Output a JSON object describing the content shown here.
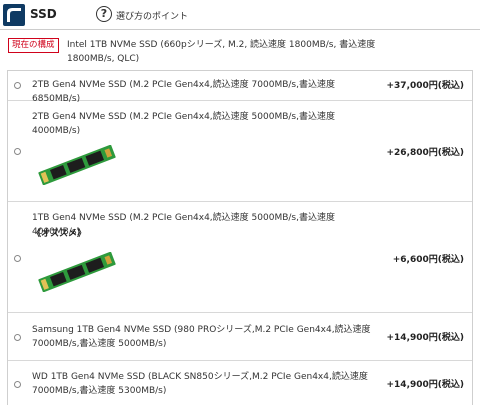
{
  "header": {
    "title": "SSD",
    "help_link": "選び方のポイント"
  },
  "current": {
    "badge": "現在の構成",
    "text": "Intel 1TB NVMe SSD (660pシリーズ, M.2, 読込速度 1800MB/s, 書込速度 1800MB/s, QLC)"
  },
  "options": [
    {
      "label": "2TB Gen4 NVMe SSD (M.2 PCIe Gen4x4,読込速度 7000MB/s,書込速度 6850MB/s)",
      "price": "+37,000円(税込)",
      "recommend": "",
      "image": ""
    },
    {
      "label": "2TB Gen4 NVMe SSD (M.2 PCIe Gen4x4,読込速度 5000MB/s,書込速度 4000MB/s)",
      "price": "+26,800円(税込)",
      "recommend": "",
      "image": "ssd-module"
    },
    {
      "label": "1TB Gen4 NVMe SSD (M.2 PCIe Gen4x4,読込速度 5000MB/s,書込速度 4000MB/s)",
      "price": "+6,600円(税込)",
      "recommend": "《オススメ》",
      "image": "ssd-module"
    },
    {
      "label": "Samsung 1TB Gen4 NVMe SSD (980 PROシリーズ,M.2 PCIe Gen4x4,読込速度 7000MB/s,書込速度 5000MB/s)",
      "price": "+14,900円(税込)",
      "recommend": "",
      "image": ""
    },
    {
      "label": "WD 1TB Gen4 NVMe SSD (BLACK SN850シリーズ,M.2 PCIe Gen4x4,読込速度 7000MB/s,書込速度 5300MB/s)",
      "price": "+14,900円(税込)",
      "recommend": "",
      "image": ""
    }
  ],
  "colors": {
    "header_icon": "#0f3a63",
    "badge_red": "#d0021b",
    "ssd_green": "#2e9a3c"
  }
}
